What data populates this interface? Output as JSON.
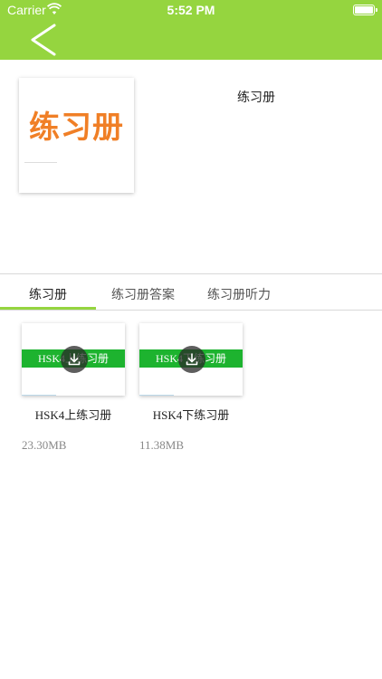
{
  "status_bar": {
    "carrier": "Carrier",
    "time": "5:52 PM"
  },
  "header": {
    "back_icon": "chevron-left-icon",
    "color": "#95d53f"
  },
  "book": {
    "cover_title": "练习册",
    "name": "练习册",
    "cover_title_color": "#f07f26"
  },
  "tabs": [
    {
      "label": "练习册",
      "active": true
    },
    {
      "label": "练习册答案",
      "active": false
    },
    {
      "label": "练习册听力",
      "active": false
    }
  ],
  "items": [
    {
      "thumb_text": "HSK4上练习册",
      "title": "HSK4上练习册",
      "size": "23.30MB"
    },
    {
      "thumb_text": "HSK4下练习册",
      "title": "HSK4下练习册",
      "size": "11.38MB"
    }
  ]
}
